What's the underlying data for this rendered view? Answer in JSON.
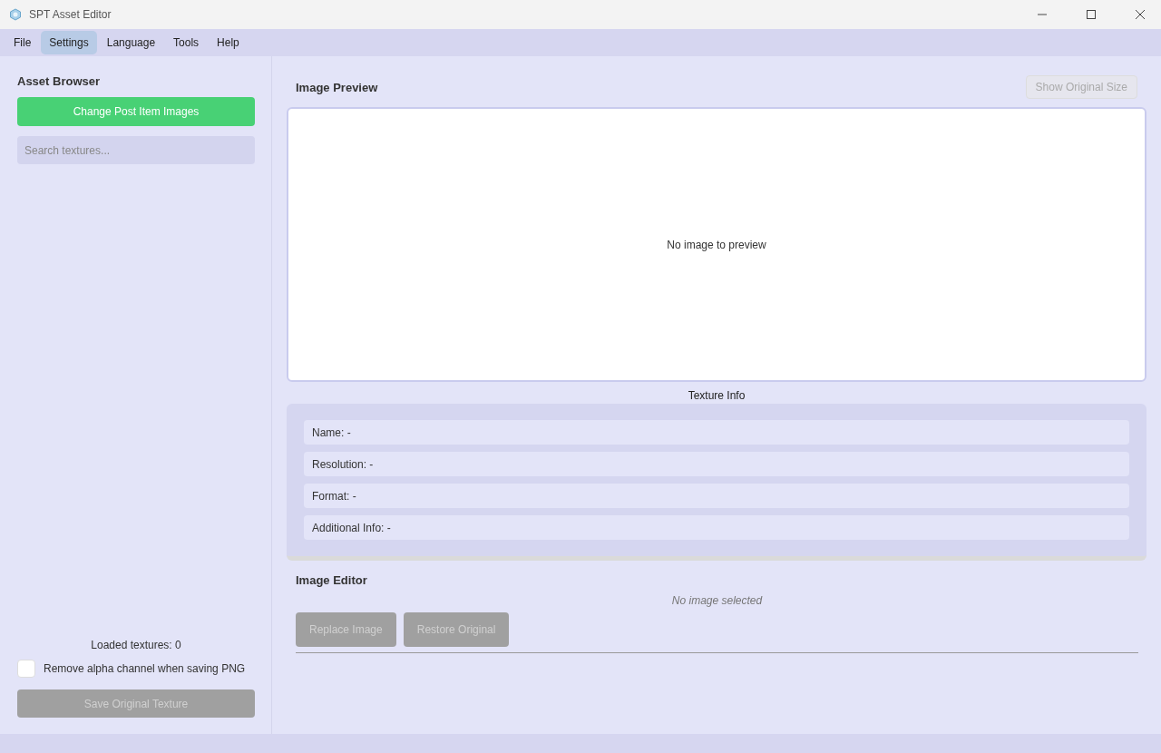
{
  "window": {
    "title": "SPT Asset Editor"
  },
  "menu": [
    {
      "label": "File",
      "selected": false
    },
    {
      "label": "Settings",
      "selected": true
    },
    {
      "label": "Language",
      "selected": false
    },
    {
      "label": "Tools",
      "selected": false
    },
    {
      "label": "Help",
      "selected": false
    }
  ],
  "sidebar": {
    "title": "Asset Browser",
    "primary_button": "Change Post Item Images",
    "search": {
      "placeholder": "Search textures..."
    },
    "loaded": "Loaded textures: 0",
    "remove_alpha": {
      "label": "Remove alpha channel when saving PNG",
      "checked": false
    },
    "save_button": {
      "label": "Save Original Texture",
      "disabled": true
    }
  },
  "preview": {
    "title": "Image Preview",
    "size_button": {
      "label": "Show Original Size",
      "disabled": true
    },
    "empty": "No image to preview"
  },
  "texture_info": {
    "title": "Texture Info",
    "rows": [
      "Name: -",
      "Resolution: -",
      "Format: -",
      "Additional Info: -"
    ]
  },
  "editor": {
    "title": "Image Editor",
    "status": "No image selected",
    "buttons": [
      {
        "label": "Replace Image",
        "disabled": true
      },
      {
        "label": "Restore Original",
        "disabled": true
      }
    ]
  }
}
